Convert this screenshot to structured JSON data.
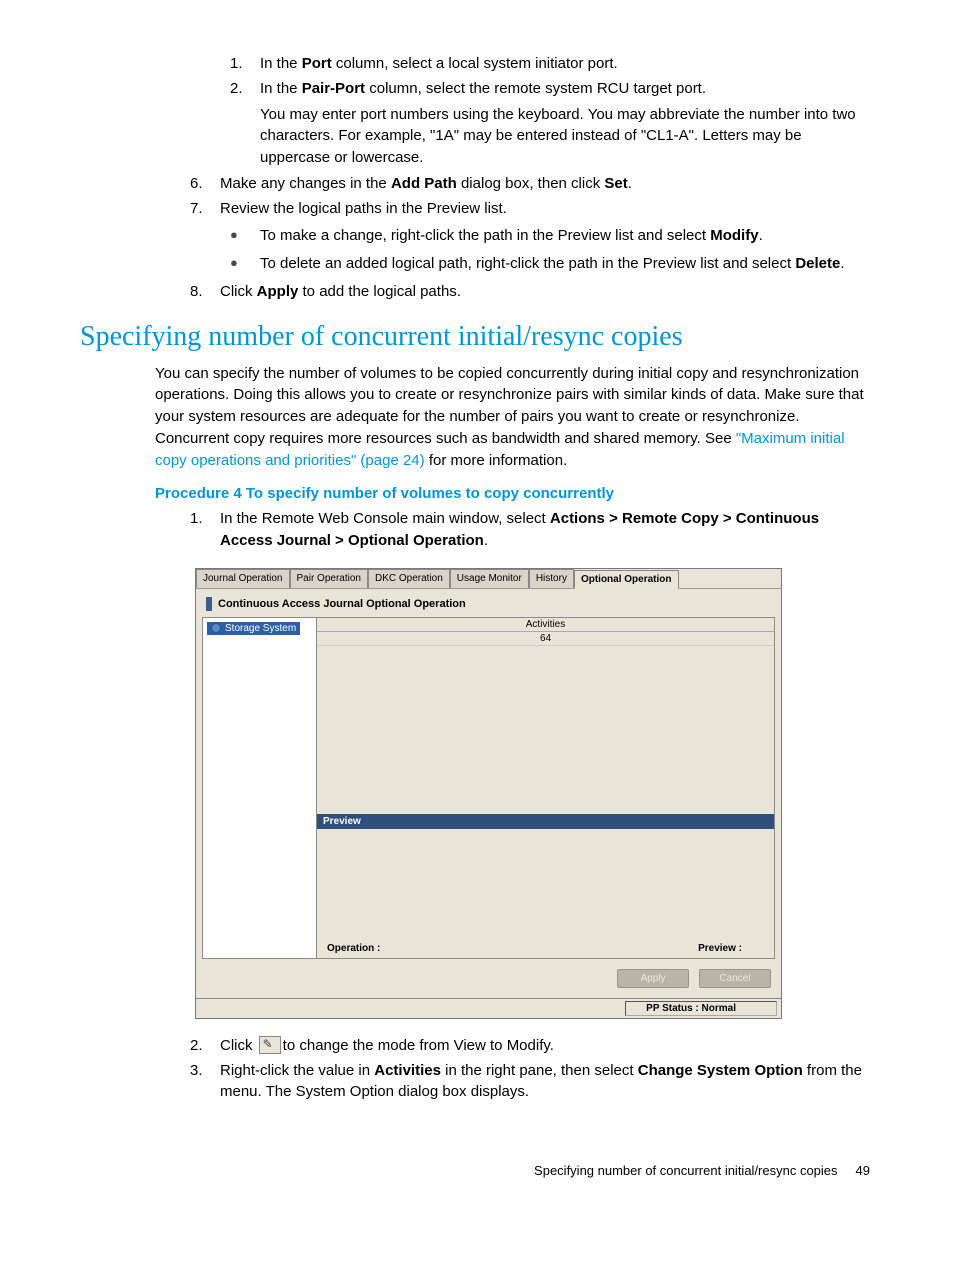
{
  "top_list": {
    "i1": {
      "num": "1.",
      "pre": "In the ",
      "bold": "Port",
      "post": " column, select a local system initiator port."
    },
    "i2": {
      "num": "2.",
      "pre": "In the ",
      "bold": "Pair-Port",
      "post": " column, select the remote system RCU target port."
    },
    "note": "You may enter port numbers using the keyboard. You may abbreviate the number into two characters. For example, \"1A\" may be entered instead of \"CL1-A\". Letters may be uppercase or lowercase."
  },
  "mid_list": {
    "i6": {
      "num": "6.",
      "pre": "Make any changes in the ",
      "b1": "Add Path",
      "mid": " dialog box, then click ",
      "b2": "Set",
      "post": "."
    },
    "i7": {
      "num": "7.",
      "text": "Review the logical paths in the Preview list."
    },
    "b1": {
      "pre": "To make a change, right-click the path in the Preview list and select ",
      "bold": "Modify",
      "post": "."
    },
    "b2": {
      "pre": "To delete an added logical path, right-click the path in the Preview list and select ",
      "bold": "Delete",
      "post": "."
    },
    "i8": {
      "num": "8.",
      "pre": "Click ",
      "bold": "Apply",
      "post": " to add the logical paths."
    }
  },
  "section_title": "Specifying number of concurrent initial/resync copies",
  "intro": {
    "pre": "You can specify the number of volumes to be copied concurrently during initial copy and resynchronization operations. Doing this allows you to create or resynchronize pairs with similar kinds of data. Make sure that your system resources are adequate for the number of pairs you want to create or resynchronize. Concurrent copy requires more resources such as bandwidth and shared memory. See ",
    "link": "\"Maximum initial copy operations and priorities\" (page 24)",
    "post": " for more information."
  },
  "proc_title": "Procedure 4 To specify number of volumes to copy concurrently",
  "proc_list": {
    "i1": {
      "num": "1.",
      "pre": "In the Remote Web Console main window, select ",
      "bold": "Actions > Remote Copy > Continuous Access Journal > Optional Operation",
      "post": "."
    },
    "i2": {
      "num": "2.",
      "pre": "Click ",
      "post": "to change the mode from View to Modify."
    },
    "i3": {
      "num": "3.",
      "pre": "Right-click the value in ",
      "b1": "Activities",
      "mid": " in the right pane, then select ",
      "b2": "Change System Option",
      "post": " from the menu. The System Option dialog box displays."
    }
  },
  "figure": {
    "tabs": [
      "Journal Operation",
      "Pair Operation",
      "DKC Operation",
      "Usage Monitor",
      "History",
      "Optional Operation"
    ],
    "active_tab": 5,
    "subtitle": "Continuous Access Journal Optional Operation",
    "tree_item": "Storage System",
    "grid_header": "Activities",
    "grid_value": "64",
    "preview_label": "Preview",
    "operation_label": "Operation :",
    "preview_status_label": "Preview :",
    "apply_btn": "Apply",
    "cancel_btn": "Cancel",
    "pp_status": "PP Status : Normal"
  },
  "footer": {
    "text": "Specifying number of concurrent initial/resync copies",
    "page": "49"
  }
}
